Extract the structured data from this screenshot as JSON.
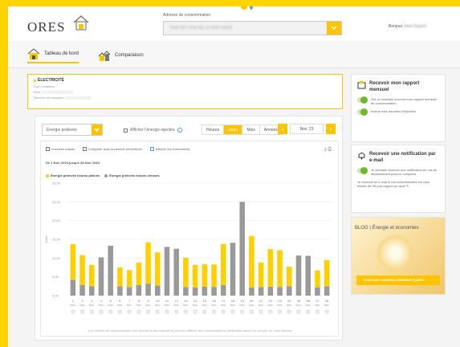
{
  "header": {
    "logo": "ORES",
    "address_label": "Adresse de consommation",
    "address_value": "RUE DE L'EGLISE 12 4000 LIEGE",
    "greeting": "Bonjour",
    "user_name": "Jean Dupont"
  },
  "tabs": [
    {
      "label": "Tableau de bord",
      "active": true
    },
    {
      "label": "Comparaison",
      "active": false
    }
  ],
  "info": {
    "title": "ÉLECTRICITÉ",
    "line1": "Cod Compteur",
    "line2_label": "EAN",
    "line2_value": "541449000000000000",
    "line3_label": "Numéro de compteur",
    "line3_value": "1SAG1234567890"
  },
  "controls": {
    "energy_select": "Énergie prélevée",
    "injected_label": "Afficher l'énergie injectée",
    "periods": [
      "Heures",
      "Jours",
      "Mois",
      "Années"
    ],
    "active_period": "Jours",
    "nav_label": "Nov. 23",
    "prev": "‹",
    "next": "›"
  },
  "options": {
    "missing": "Données malais",
    "compare": "Comparer avec la période précédente",
    "events": "Afficher les événements"
  },
  "chart_data": {
    "type": "bar",
    "subtitle": "De 1 Nov. 2023 jusque 28 Nov. 2023",
    "ylabel": "kWh",
    "ylim": [
      0,
      30
    ],
    "yticks": [
      "30,00",
      "25,00",
      "20,00",
      "15,00",
      "10,00",
      "5,00",
      "0,00"
    ],
    "colors": {
      "pleines": "#ffd000",
      "creuses": "#9a9a9a"
    },
    "categories": [
      "1",
      "2",
      "3",
      "4",
      "5",
      "6",
      "7",
      "8",
      "9",
      "10",
      "11",
      "12",
      "13",
      "14",
      "15",
      "16",
      "17",
      "18",
      "19",
      "20",
      "21",
      "22",
      "23",
      "24",
      "25",
      "26",
      "27",
      "28"
    ],
    "month_label": "Nov.",
    "series": [
      {
        "name": "Énergie prélevée heures pleines",
        "values": [
          9.5,
          8,
          5.7,
          0,
          0,
          5,
          4.5,
          6,
          11,
          8.8,
          0,
          0,
          7.8,
          6,
          6,
          6,
          11,
          0,
          0,
          13.7,
          6.5,
          10,
          9.8,
          5.2,
          0,
          0,
          4.5,
          7
        ]
      },
      {
        "name": "Énergie prélevée heures creuses",
        "values": [
          4.2,
          2.8,
          2.5,
          10.2,
          13.3,
          2.5,
          2.3,
          2.8,
          3.2,
          2.7,
          13,
          12.5,
          2.3,
          2.2,
          2.4,
          2.3,
          2.8,
          14.1,
          25,
          2.2,
          2.3,
          2.4,
          2.3,
          2.5,
          10.7,
          10.6,
          2.2,
          2.5
        ]
      }
    ]
  },
  "footnote": "Les relevés de consommation sont donnés à titre indicatif et peuvent différer des consommations réellement prises en compte sur votre facture.",
  "side1": {
    "title": "Recevoir mon rapport mensuel",
    "toggle1": "Oui, je souhaite recevoir mon rapport mensuel de consommation",
    "toggle2": "Inclure mes données d'injection"
  },
  "side2": {
    "title": "Recevoir une notification par e-mail",
    "toggle1": "Je souhaite recevoir une notification en cas de dépassement pour ce compteur",
    "note": "Je recevrai un e-mail si ma consommation est plus élevée de 5% par rapport au seuil"
  },
  "blog": {
    "title": "BLOG | Énergie et économies",
    "button": "TOUS NOS CONSEILS ÉNERGÉTIQUES"
  }
}
